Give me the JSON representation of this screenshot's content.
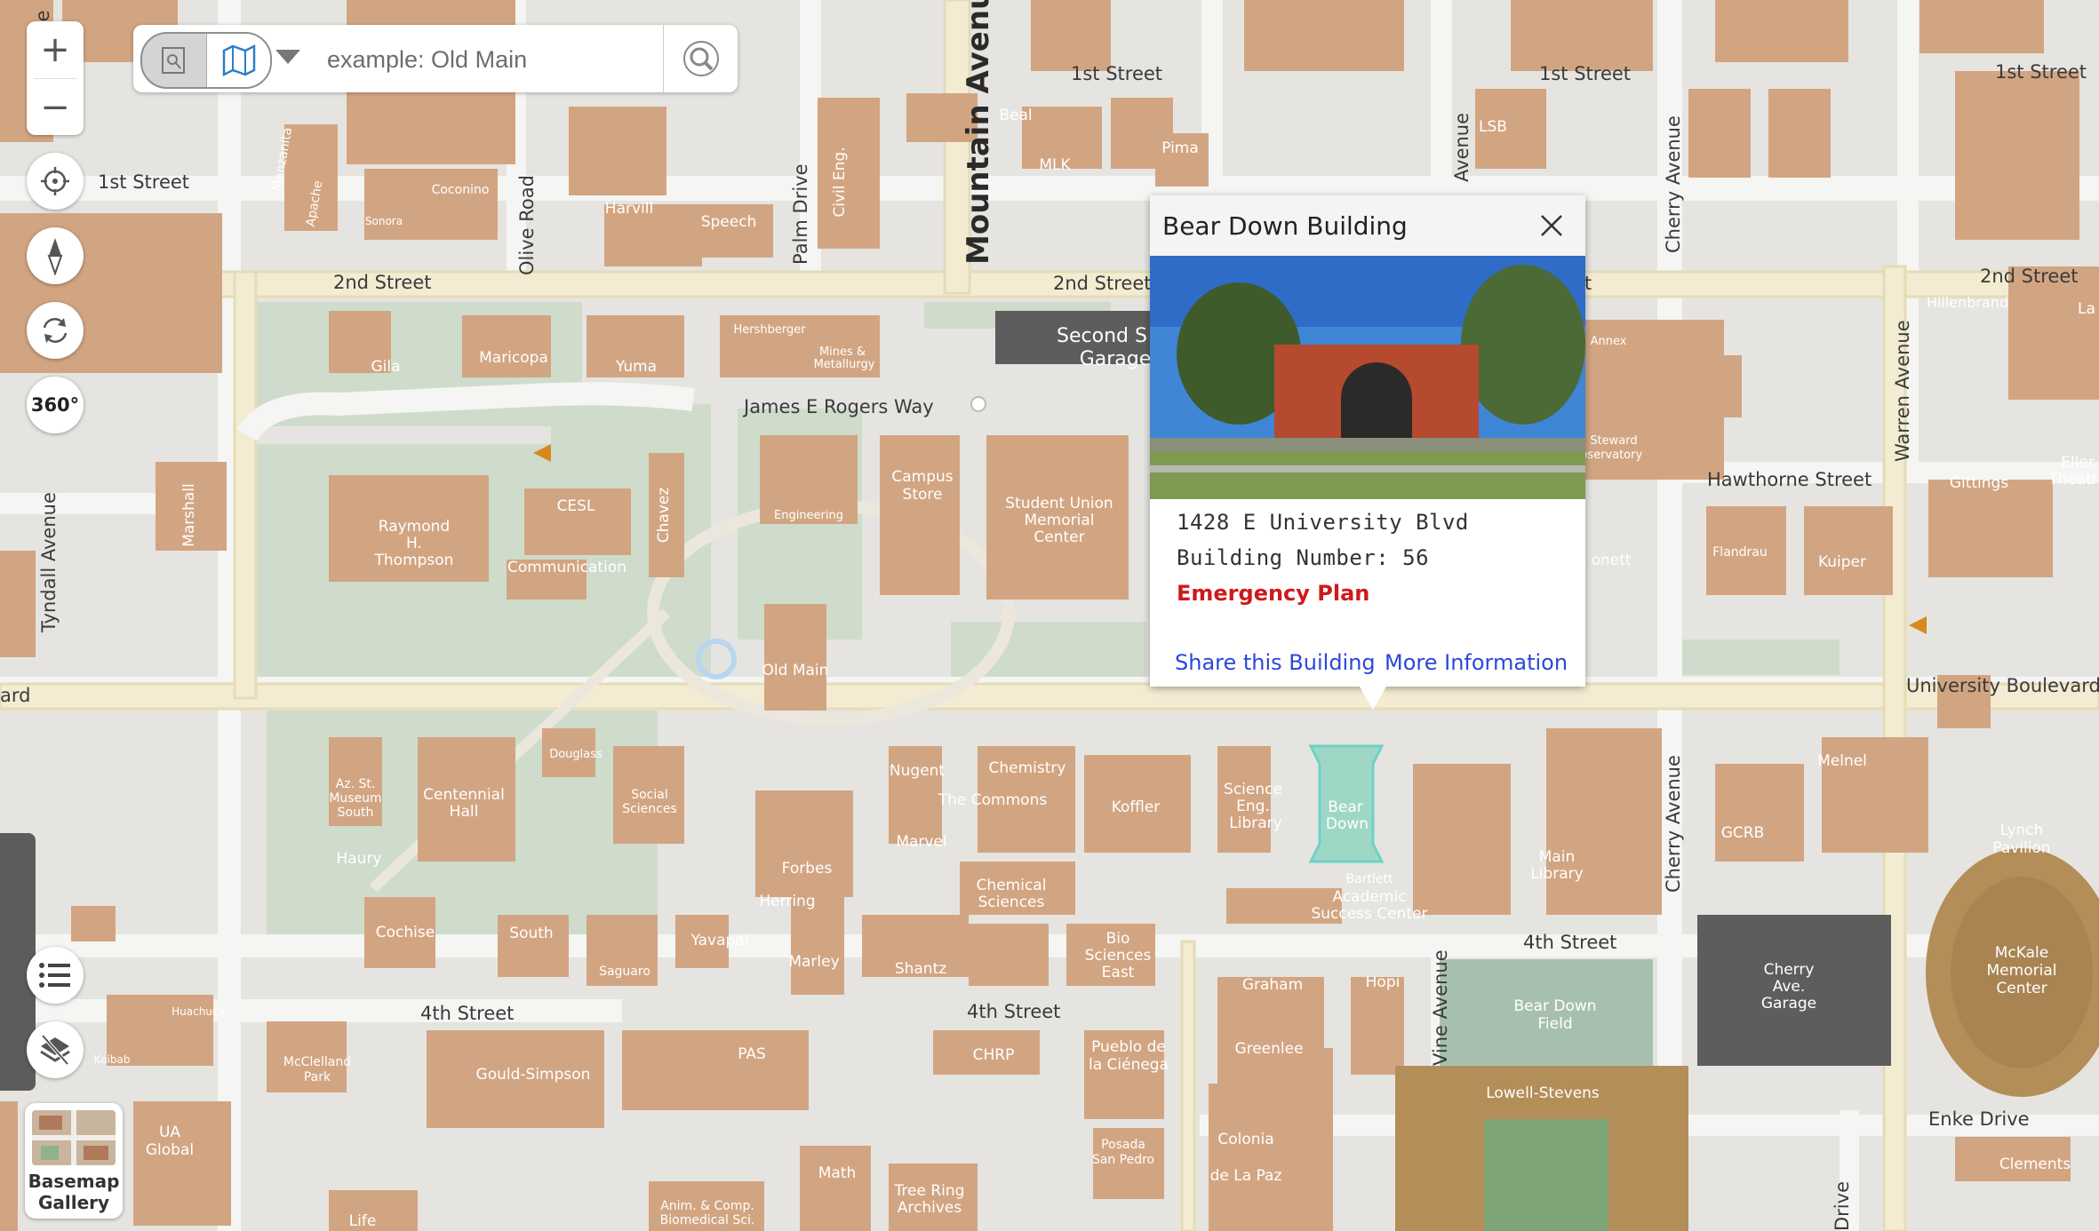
{
  "search": {
    "placeholder": "example: Old Main"
  },
  "popup": {
    "title": "Bear Down Building",
    "address": "1428 E University Blvd",
    "building_number": "Building Number: 56",
    "emergency_plan": "Emergency Plan",
    "share_link": "Share this Building",
    "more_link": "More Information"
  },
  "basemap": {
    "line1": "Basemap",
    "line2": "Gallery"
  },
  "tools": {
    "label_360": "360°"
  },
  "colors": {
    "building": "#d2a582",
    "highlight": "#9fd7c6",
    "road": "#f5f5f3",
    "arterial": "#f3ecd2",
    "green": "#cfdccb",
    "garage": "#5d5d5d",
    "link": "#2b47d8",
    "emergency": "#d0191b"
  },
  "map": {
    "streets": {
      "s1": "1st Street",
      "s2": "1st Street",
      "s3": "1st Street",
      "s4": "1st Street",
      "s5": "2nd Street",
      "s6": "2nd Street",
      "s7": "2nd Street",
      "s8": "James E Rogers Way",
      "s9": "Hawthorne Street",
      "s10": "University Boulevard",
      "s11": "4th Street",
      "s12": "4th Street",
      "s13": "4th Street",
      "s14": "Enke Drive",
      "s15": "Tyndall Avenue",
      "s16": "Olive Road",
      "s17": "Palm Drive",
      "s18": "Mountain Avenue",
      "s19": "Cherry Avenue",
      "s20": "Cherry Avenue",
      "s21": "Warren Avenue",
      "s22": "Vine Avenue",
      "s23": "Avenue",
      "s24": "Ave",
      "s25": "Drive",
      "s26": "ard",
      "s27": "et"
    },
    "buildings": {
      "b1": "Gila",
      "b2": "Maricopa",
      "b3": "Yuma",
      "b4": "Hershberger",
      "b5": "Mines &",
      "b6": "Metallurgy",
      "b7": "Harvill",
      "b8": "Speech",
      "b9": "Coconino",
      "b10": "Manzanita",
      "b11": "Apache",
      "b12": "Sonora",
      "b13": "Civil Eng.",
      "b14": "Beal",
      "b15": "MLK",
      "b16": "Pima",
      "b17": "LSB",
      "b18": "Raymond",
      "b19": "H.",
      "b20": "Thompson",
      "b21": "CESL",
      "b22": "Communication",
      "b23": "Chavez",
      "b24": "Marshall",
      "b25": "Engineering",
      "b26": "Campus",
      "b27": "Store",
      "b28": "Student Union",
      "b29": "Memorial",
      "b30": "Center",
      "b31": "Second S",
      "b32": "Garage",
      "b33": "Old Main",
      "b34": "Nugent",
      "b35": "Chemistry",
      "b36": "The Commons",
      "b37": "Koffler",
      "b38": "Science",
      "b39": "Eng.",
      "b40": "Library",
      "b41": "Bear",
      "b42": "Down",
      "b43": "Bartlett",
      "b44": "Academic",
      "b45": "Success Center",
      "b46": "Main",
      "b47": "Library",
      "b48": "Melnel",
      "b49": "GCRB",
      "b50": "Lynch",
      "b51": "Pavilion",
      "b52": "McKale",
      "b53": "Memorial",
      "b54": "Center",
      "b55": "Cherry",
      "b56": "Ave.",
      "b57": "Garage",
      "b58": "Bear Down",
      "b59": "Field",
      "b60": "Lowell-Stevens",
      "b61": "Az. St.",
      "b62": "Museum",
      "b63": "South",
      "b64": "Haury",
      "b65": "Centennial",
      "b66": "Hall",
      "b67": "Douglass",
      "b68": "Social",
      "b69": "Sciences",
      "b70": "Forbes",
      "b71": "Marvel",
      "b72": "Herring",
      "b73": "Chemical",
      "b74": "Sciences",
      "b75": "Cochise",
      "b76": "South",
      "b77": "Saguaro",
      "b78": "Yavapai",
      "b79": "Marley",
      "b80": "Shantz",
      "b81": "Bio",
      "b82": "Sciences",
      "b83": "East",
      "b84": "Graham",
      "b85": "Hopi",
      "b86": "Greenlee",
      "b87": "McClelland",
      "b88": "Park",
      "b89": "Gould-Simpson",
      "b90": "PAS",
      "b91": "CHRP",
      "b92": "Pueblo de",
      "b93": "la Ciénega",
      "b94": "Posada",
      "b95": "San Pedro",
      "b96": "Colonia",
      "b97": "de La Paz",
      "b98": "Math",
      "b99": "Tree Ring",
      "b100": "Archives",
      "b101": "Anim. & Comp.",
      "b102": "Biomedical Sci.",
      "b103": "Life",
      "b104": "UA",
      "b105": "Global",
      "b106": "Huachuca",
      "b107": "Kaibab",
      "b108": "Hillenbrand",
      "b109": "La",
      "b110": "Gittings",
      "b111": "Eller",
      "b112": "Theatre",
      "b113": "Flandrau",
      "b114": "Kuiper",
      "b115": "Annex",
      "b116": "Steward",
      "b117": "Observatory",
      "b118": "onett",
      "b119": "Clements"
    }
  }
}
